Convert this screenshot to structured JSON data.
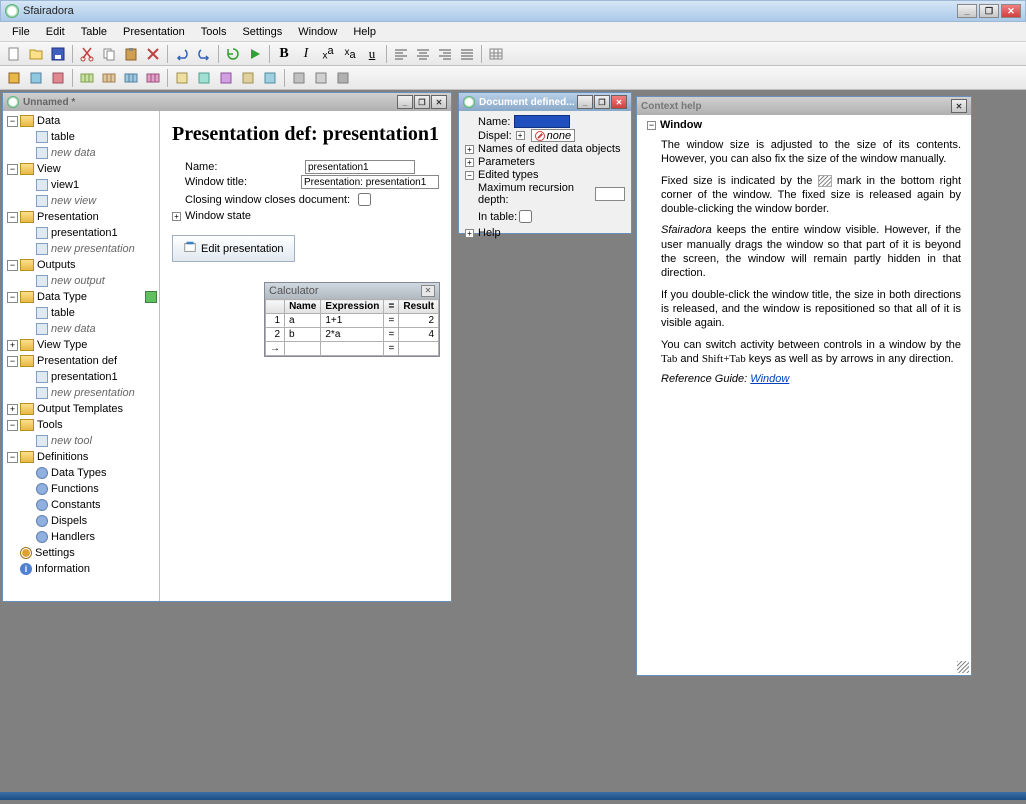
{
  "app": {
    "title": "Sfairadora"
  },
  "menu": [
    "File",
    "Edit",
    "Table",
    "Presentation",
    "Tools",
    "Settings",
    "Window",
    "Help"
  ],
  "win_unnamed": {
    "title": "Unnamed *"
  },
  "tree": {
    "data": "Data",
    "table": "table",
    "newdata": "new data",
    "view": "View",
    "view1": "view1",
    "newview": "new view",
    "presentation": "Presentation",
    "presentation1": "presentation1",
    "newpresentation": "new presentation",
    "outputs": "Outputs",
    "newoutput": "new output",
    "datatype": "Data Type",
    "viewtype": "View Type",
    "presdef": "Presentation def",
    "outtpl": "Output Templates",
    "tools": "Tools",
    "newtool": "new tool",
    "definitions": "Definitions",
    "datatypes": "Data Types",
    "functions": "Functions",
    "constants": "Constants",
    "dispels": "Dispels",
    "handlers": "Handlers",
    "settings": "Settings",
    "information": "Information"
  },
  "main": {
    "heading": "Presentation def: presentation1",
    "name_label": "Name:",
    "name_value": "presentation1",
    "wtitle_label": "Window title:",
    "wtitle_value": "Presentation: presentation1",
    "closing_label": "Closing window closes document:",
    "state_label": "Window state",
    "edit_btn": "Edit presentation"
  },
  "calc": {
    "title": "Calculator",
    "h_name": "Name",
    "h_expr": "Expression",
    "h_eq": "=",
    "h_result": "Result",
    "r1_num": "1",
    "r1_name": "a",
    "r1_expr": "1+1",
    "r1_eq": "=",
    "r1_res": "2",
    "r2_num": "2",
    "r2_name": "b",
    "r2_expr": "2*a",
    "r2_eq": "=",
    "r2_res": "4",
    "r3_eq": "="
  },
  "doc": {
    "title": "Document defined...",
    "name_label": "Name:",
    "dispel_label": "Dispel:",
    "dispel_value": "none",
    "names_edited": "Names of edited data objects",
    "parameters": "Parameters",
    "edited_types": "Edited types",
    "maxrec": "Maximum recursion depth:",
    "intable": "In table:",
    "help": "Help"
  },
  "help": {
    "title": "Context help",
    "section": "Window",
    "p1": "The window size is adjusted to the size of its contents. However, you can also fix the size of the window manually.",
    "p2a": "Fixed size is indicated by the ",
    "p2b": " mark in the bottom right corner of the window. The fixed size is released again by double-clicking the window border.",
    "p3a": "Sfairadora",
    "p3b": " keeps the entire window visible. However, if the user manually drags the window so that part of it is beyond the screen, the window will remain partly hidden in that direction.",
    "p4": "If you double-click the window title, the size in both directions is released, and the window is repositioned so that all of it is visible again.",
    "p5a": "You can switch activity between controls in a window by the ",
    "p5b": "Tab",
    "p5c": " and ",
    "p5d": "Shift+Tab",
    "p5e": " keys as well as by arrows in any direction.",
    "ref_label": "Reference Guide",
    "ref_colon": ": ",
    "ref_link": "Window"
  }
}
